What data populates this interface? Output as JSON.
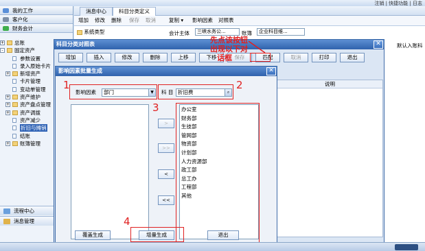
{
  "topbar": {
    "right_text": "注销 | 快捷功能 | 日志"
  },
  "sidebar": {
    "sections": [
      "我的工作",
      "客户化",
      "财务会计"
    ],
    "tree": [
      {
        "label": "总账",
        "level": 0,
        "type": "folder",
        "expander": "+"
      },
      {
        "label": "固定资产",
        "level": 0,
        "type": "folder",
        "expander": "-"
      },
      {
        "label": "参数设置",
        "level": 1,
        "type": "doc"
      },
      {
        "label": "录入原始卡片",
        "level": 1,
        "type": "doc"
      },
      {
        "label": "新增资产",
        "level": 1,
        "type": "folder",
        "expander": "+"
      },
      {
        "label": "卡片管理",
        "level": 1,
        "type": "doc"
      },
      {
        "label": "变动单管理",
        "level": 1,
        "type": "doc"
      },
      {
        "label": "资产维护",
        "level": 1,
        "type": "folder",
        "expander": "+"
      },
      {
        "label": "资产盘点管理",
        "level": 1,
        "type": "folder",
        "expander": "+"
      },
      {
        "label": "资产调拨",
        "level": 1,
        "type": "folder",
        "expander": "+"
      },
      {
        "label": "资产减少",
        "level": 1,
        "type": "doc"
      },
      {
        "label": "折旧与摊销",
        "level": 1,
        "type": "doc",
        "selected": true
      },
      {
        "label": "结账",
        "level": 1,
        "type": "doc"
      },
      {
        "label": "账簿管理",
        "level": 1,
        "type": "folder",
        "expander": "+"
      }
    ],
    "bottom": [
      "流程中心",
      "消息管理"
    ]
  },
  "tabs": [
    "消息中心",
    "科目分类定义"
  ],
  "toolbar": {
    "items": [
      {
        "label": "增加",
        "disabled": false
      },
      {
        "label": "修改",
        "disabled": false
      },
      {
        "label": "删除",
        "disabled": false
      },
      {
        "label": "保存",
        "disabled": true
      },
      {
        "label": "取消",
        "disabled": true
      },
      {
        "label": "复制 ▾",
        "disabled": false
      },
      {
        "label": "影响因素",
        "disabled": false
      },
      {
        "label": "对照表",
        "disabled": false
      }
    ]
  },
  "main": {
    "tree_first": "系统类型",
    "accounting_entity_label": "会计主体",
    "accounting_entity_value": "三峡水务公...",
    "ledger_label": "账簿",
    "ledger_value": "企业科目维...",
    "col_header_right": "默认入账科"
  },
  "map_dialog": {
    "title": "科目分类对照表",
    "buttons": [
      {
        "label": "增加",
        "disabled": false
      },
      {
        "label": "插入",
        "disabled": false
      },
      {
        "label": "修改",
        "disabled": false
      },
      {
        "label": "删除",
        "disabled": false
      },
      {
        "label": "上移",
        "disabled": false
      },
      {
        "label": "下移",
        "disabled": false
      },
      {
        "label": "保存",
        "disabled": true
      },
      {
        "label": "匹配",
        "disabled": false
      },
      {
        "label": "取消",
        "disabled": true
      },
      {
        "label": "打印",
        "disabled": false
      },
      {
        "label": "退出",
        "disabled": false
      }
    ],
    "grid_header": "说明"
  },
  "batch_dialog": {
    "title": "影响因素批量生成",
    "factor_label": "影响因素",
    "factor_value": "部门",
    "account_label": "科 目",
    "account_value": "折旧费",
    "move_buttons": [
      ">",
      ">>",
      "<",
      "<<"
    ],
    "selected_items": [
      "办公室",
      "财务部",
      "生技部",
      "管网部",
      "物资部",
      "计划部",
      "人力资源部",
      "政工部",
      "总工办",
      "工程部",
      "其他"
    ],
    "footer_buttons": [
      "覆盖生成",
      "增量生成",
      "退出"
    ]
  },
  "annotations": {
    "numbers": [
      "1",
      "2",
      "3",
      "4"
    ],
    "note_lines": [
      "先点该按钮",
      "出现以下对",
      "话框"
    ]
  }
}
